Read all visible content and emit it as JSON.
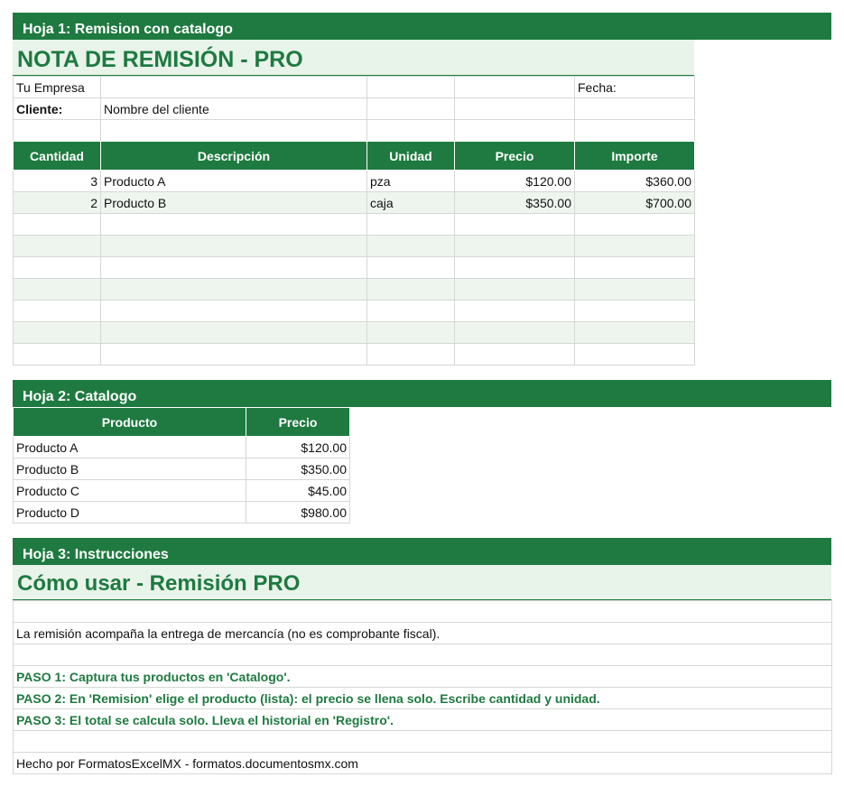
{
  "sheet1": {
    "banner": "Hoja 1: Remision con catalogo",
    "title": "NOTA DE REMISIÓN - PRO",
    "company_label": "Tu Empresa",
    "date_label": "Fecha:",
    "client_label": "Cliente:",
    "client_value": "Nombre del cliente",
    "headers": [
      "Cantidad",
      "Descripción",
      "Unidad",
      "Precio",
      "Importe"
    ],
    "rows": [
      {
        "qty": "3",
        "desc": "Producto A",
        "unit": "pza",
        "price": "$120.00",
        "amount": "$360.00"
      },
      {
        "qty": "2",
        "desc": "Producto B",
        "unit": "caja",
        "price": "$350.00",
        "amount": "$700.00"
      }
    ]
  },
  "sheet2": {
    "banner": "Hoja 2: Catalogo",
    "headers": [
      "Producto",
      "Precio"
    ],
    "rows": [
      {
        "product": "Producto A",
        "price": "$120.00"
      },
      {
        "product": "Producto B",
        "price": "$350.00"
      },
      {
        "product": "Producto C",
        "price": "$45.00"
      },
      {
        "product": "Producto D",
        "price": "$980.00"
      }
    ]
  },
  "sheet3": {
    "banner": "Hoja 3: Instrucciones",
    "title": "Cómo usar - Remisión PRO",
    "intro": "La remisión acompaña la entrega de mercancía (no es comprobante fiscal).",
    "step1": "PASO 1: Captura tus productos en 'Catalogo'.",
    "step2": "PASO 2: En 'Remision' elige el producto (lista): el precio se llena solo. Escribe cantidad y unidad.",
    "step3": "PASO 3: El total se calcula solo. Lleva el historial en 'Registro'.",
    "footer": "Hecho por FormatosExcelMX - formatos.documentosmx.com"
  },
  "colors": {
    "accent": "#1e7a40",
    "band": "#eef5ef",
    "title_bg": "#e8f3ea"
  }
}
